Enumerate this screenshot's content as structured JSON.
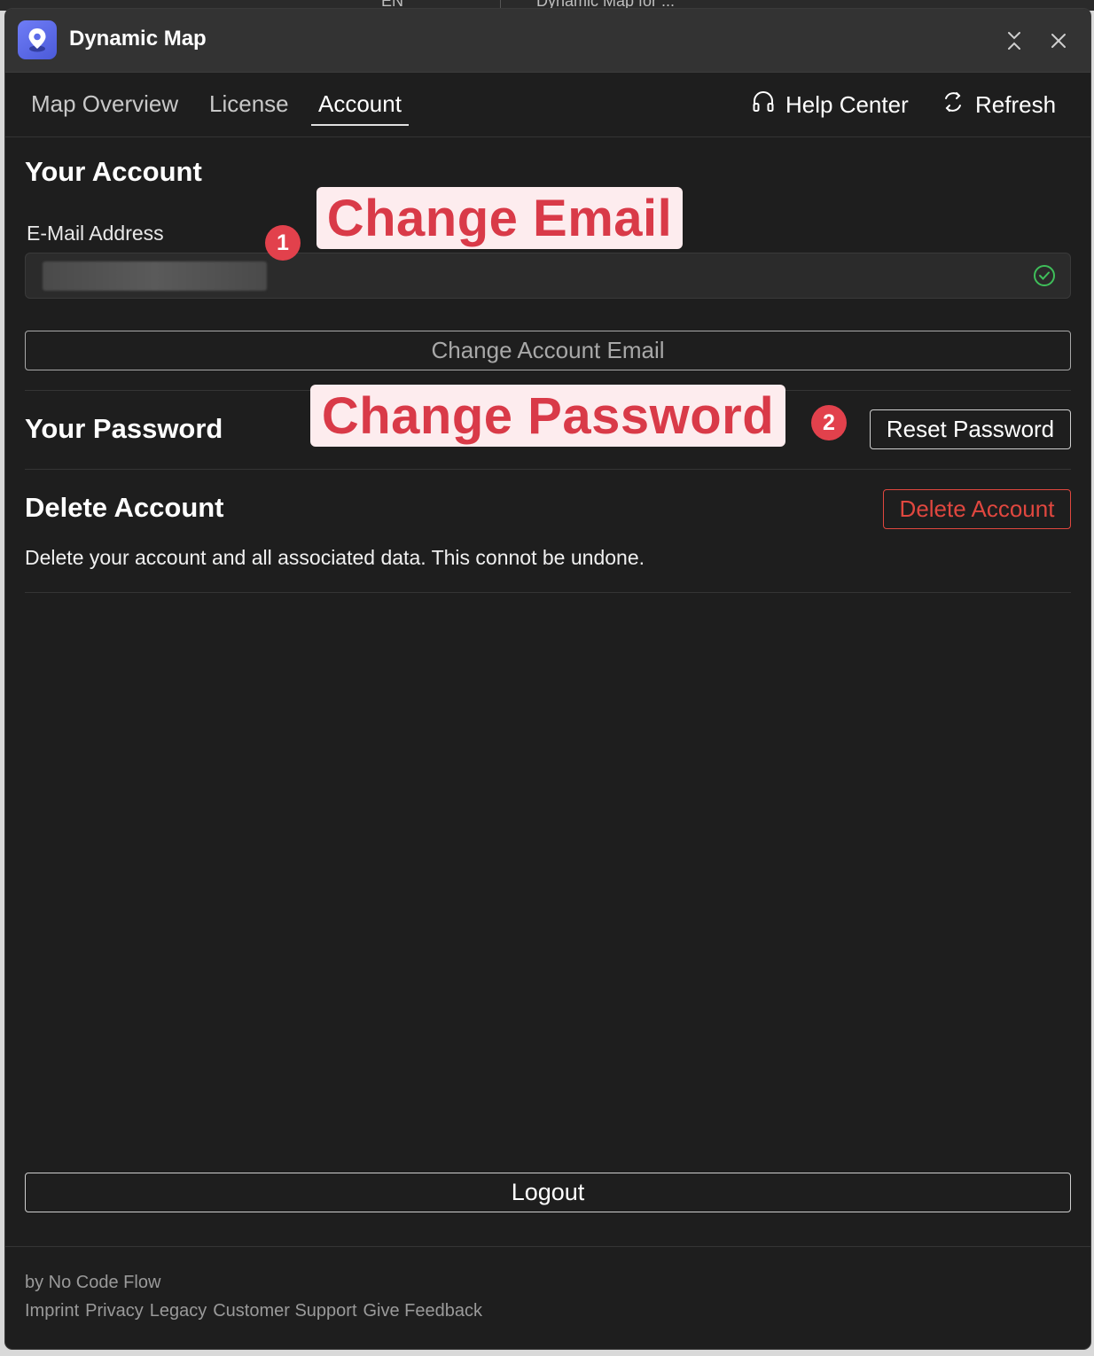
{
  "background": {
    "lang": "EN",
    "doc": "Dynamic Map for ..."
  },
  "window": {
    "title": "Dynamic Map",
    "icons": {
      "app": "map-pin-icon",
      "collapse": "collapse-icon",
      "close": "close-icon"
    }
  },
  "nav": {
    "tabs": [
      {
        "label": "Map Overview",
        "active": false
      },
      {
        "label": "License",
        "active": false
      },
      {
        "label": "Account",
        "active": true
      }
    ],
    "help_label": "Help Center",
    "refresh_label": "Refresh",
    "icons": {
      "help": "headset-icon",
      "refresh": "refresh-icon"
    }
  },
  "account": {
    "heading": "Your Account",
    "email_label": "E-Mail Address",
    "email_value": "",
    "email_verified_icon": "check-circle-icon",
    "change_email_button": "Change Account Email"
  },
  "password": {
    "heading": "Your Password",
    "reset_button": "Reset Password"
  },
  "delete": {
    "heading": "Delete Account",
    "button": "Delete Account",
    "description": "Delete your account and all associated data. This connot be undone."
  },
  "logout_button": "Logout",
  "footer": {
    "by": "by No Code Flow",
    "links": [
      "Imprint",
      "Privacy",
      "Legacy",
      "Customer Support",
      "Give Feedback"
    ]
  },
  "annotations": {
    "callout_1": "Change Email",
    "callout_2": "Change Password",
    "marker_1": "1",
    "marker_2": "2",
    "color": "#e2414c"
  },
  "colors": {
    "window_bg": "#1e1e1e",
    "titlebar_bg": "#333333",
    "danger": "#e0473f",
    "success": "#3fbf5a",
    "accent": "#5b6be8"
  }
}
